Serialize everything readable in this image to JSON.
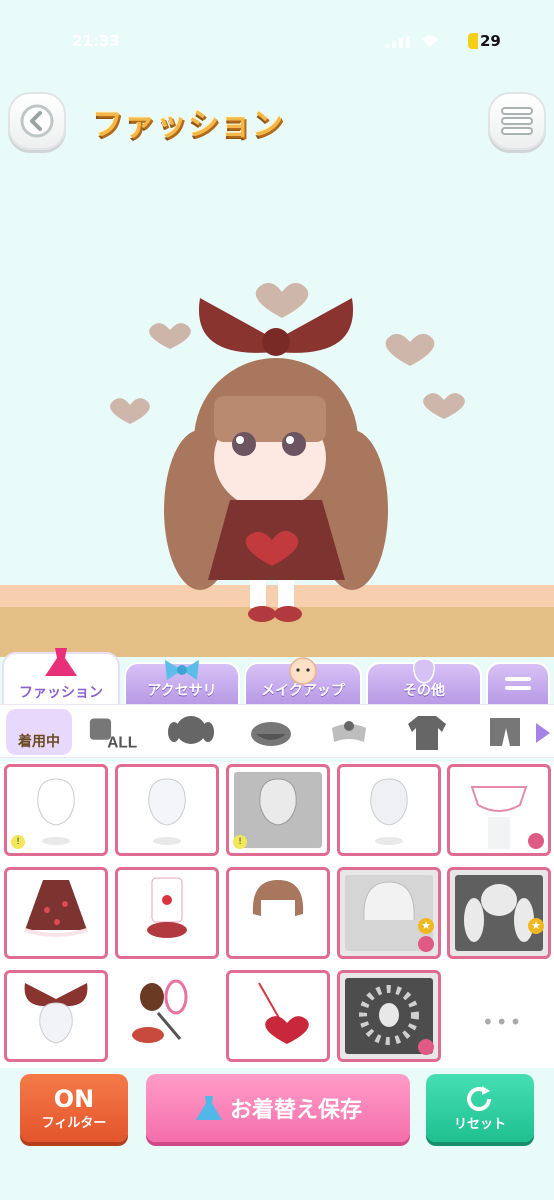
{
  "status": {
    "time": "21:33",
    "battery": "29"
  },
  "header": {
    "title": "ファッション"
  },
  "category_tabs": [
    {
      "label": "ファッション",
      "icon": "dress-icon"
    },
    {
      "label": "アクセサリ",
      "icon": "ribbon-icon"
    },
    {
      "label": "メイクアップ",
      "icon": "face-icon"
    },
    {
      "label": "その他",
      "icon": "misc-icon"
    }
  ],
  "sub_tabs": {
    "wearing_label": "着用中",
    "all_label": "ALL"
  },
  "grid": {
    "more": "•••"
  },
  "buttons": {
    "filter_on": "ON",
    "filter_label": "フィルター",
    "save_label": "お着替え保存",
    "reset_label": "リセット"
  },
  "colors": {
    "background": "#e9fbf8",
    "tab_purple": "#b89ae6",
    "cell_border": "#e06c92",
    "filter_orange": "#e3552b",
    "save_pink": "#f56fab",
    "reset_green": "#1fc090"
  }
}
